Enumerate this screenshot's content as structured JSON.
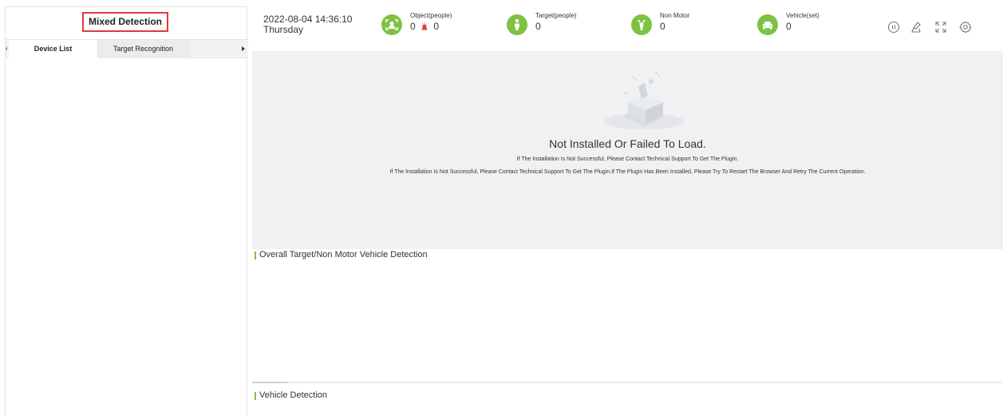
{
  "left_panel": {
    "title": "Mixed Detection",
    "tabs": [
      {
        "label": "Device List",
        "active": true
      },
      {
        "label": "Target Recognition",
        "active": false
      }
    ]
  },
  "topbar": {
    "datetime": "2022-08-04 14:36:10",
    "weekday": "Thursday",
    "stats": {
      "object": {
        "label": "Object(people)",
        "value": "0",
        "alarm_value": "0",
        "icon": "face-frame-icon"
      },
      "target": {
        "label": "Target(people)",
        "value": "0",
        "icon": "person-icon"
      },
      "non_motor": {
        "label": "Non Motor",
        "value": "0",
        "icon": "scooter-icon"
      },
      "vehicle": {
        "label": "Vehicle(set)",
        "value": "0",
        "icon": "car-icon"
      }
    },
    "tools": [
      "pause-icon",
      "clear-icon",
      "fullscreen-icon",
      "settings-gear-icon"
    ]
  },
  "video": {
    "title": "Not Installed Or Failed To Load.",
    "line1": "If The Installation Is Not Successful, Please Contact Technical Support To Get The Plugin.",
    "line2": "If The Installation Is Not Successful, Please Contact Technical Support To Get The Plugin.If The Plugin Has Been Installed, Please Try To Restart The Browser And Retry The Current Operation."
  },
  "sections": {
    "overall": "Overall Target/Non Motor Vehicle Detection",
    "vehicle": "Vehicle Detection"
  },
  "colors": {
    "accent": "#7dc243",
    "highlight_border": "#e0393e",
    "alarm": "#e53935"
  }
}
